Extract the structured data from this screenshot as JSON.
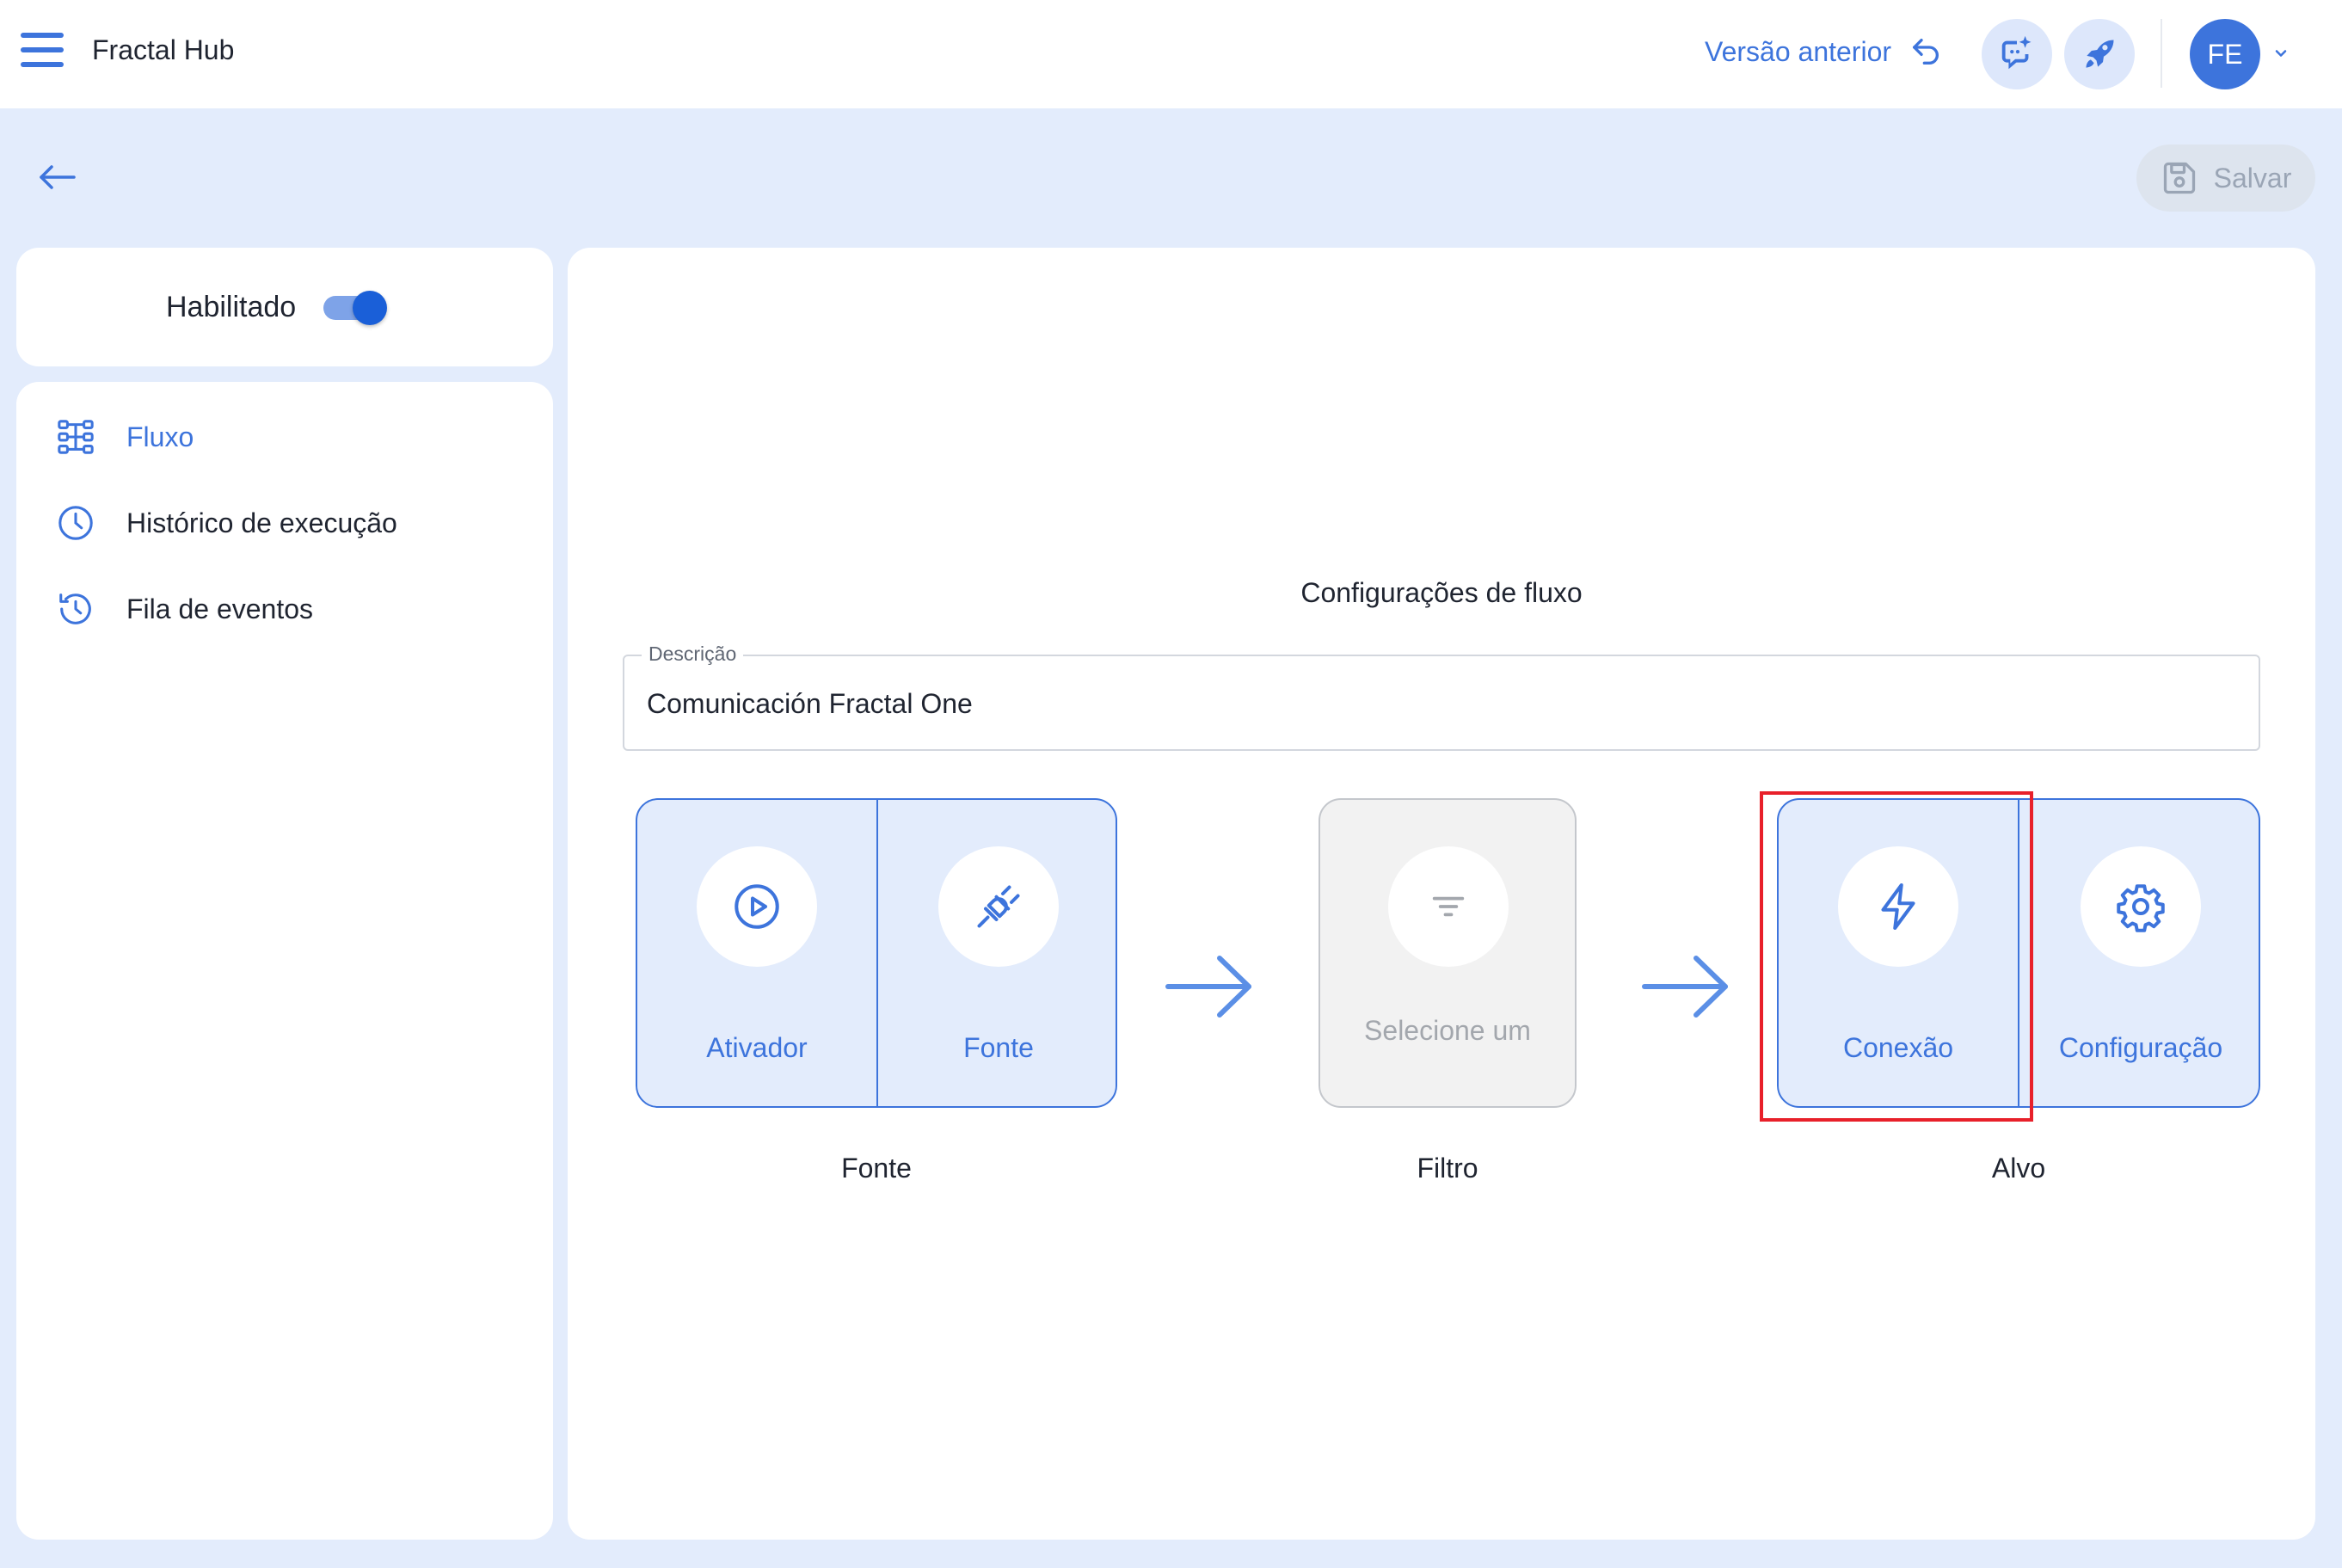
{
  "header": {
    "app_title": "Fractal Hub",
    "previous_version_label": "Versão anterior",
    "avatar_initials": "FE",
    "icons": {
      "menu": "hamburger-menu-icon",
      "undo": "undo-arrow-icon",
      "chat": "chat-sparkle-icon",
      "rocket": "rocket-icon",
      "chevron": "chevron-down-icon"
    }
  },
  "toolbar": {
    "back_icon": "arrow-left-icon",
    "save_label": "Salvar",
    "save_icon": "floppy-disk-icon"
  },
  "status": {
    "enabled_label": "Habilitado",
    "enabled": true
  },
  "sidebar": {
    "items": [
      {
        "label": "Fluxo",
        "icon": "flow-diagram-icon",
        "active": true
      },
      {
        "label": "Histórico de execução",
        "icon": "clock-icon",
        "active": false
      },
      {
        "label": "Fila de eventos",
        "icon": "history-clock-icon",
        "active": false
      }
    ]
  },
  "main": {
    "title": "Configurações de fluxo",
    "description": {
      "label": "Descrição",
      "value": "Comunicación Fractal One"
    },
    "groups": {
      "source": {
        "caption": "Fonte",
        "items": [
          {
            "label": "Ativador",
            "icon": "play-circle-icon"
          },
          {
            "label": "Fonte",
            "icon": "plug-icon"
          }
        ]
      },
      "filter": {
        "caption": "Filtro",
        "items": [
          {
            "label": "Selecione um",
            "icon": "filter-lines-icon"
          }
        ]
      },
      "target": {
        "caption": "Alvo",
        "items": [
          {
            "label": "Conexão",
            "icon": "lightning-icon"
          },
          {
            "label": "Configuração",
            "icon": "gear-icon"
          }
        ]
      }
    },
    "highlight_color": "#e8202a"
  },
  "colors": {
    "accent": "#3d74dc",
    "page_background": "#e3ecfc",
    "disabled_text": "#a3a7ad"
  }
}
